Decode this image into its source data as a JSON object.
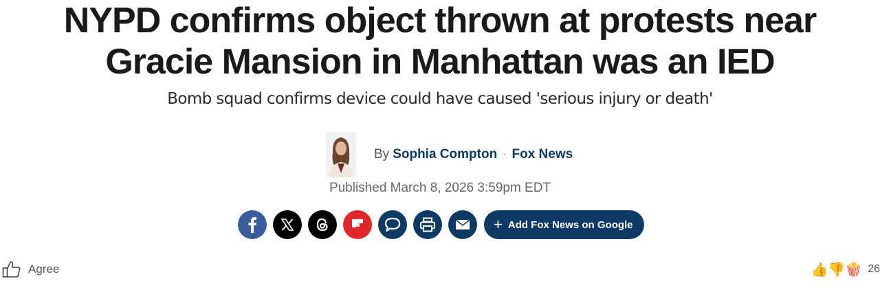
{
  "article": {
    "headline": "NYPD confirms object thrown at protests near Gracie Mansion in Manhattan was an IED",
    "subheadline": "Bomb squad confirms device could have caused 'serious injury or death'",
    "byline": {
      "by_label": "By",
      "author": "Sophia Compton",
      "separator": "·",
      "outlet": "Fox News"
    },
    "published": "Published March 8, 2026 3:59pm EDT"
  },
  "share": {
    "icons": [
      "facebook-icon",
      "x-icon",
      "threads-icon",
      "flipboard-icon",
      "comment-icon",
      "print-icon",
      "email-icon"
    ],
    "google_button_plus": "+",
    "google_button_label": "Add Fox News on Google"
  },
  "footer": {
    "agree_label": "Agree",
    "reaction_emojis": "👍👎🍿",
    "reaction_count": "26"
  },
  "colors": {
    "brand_navy": "#0f3a66",
    "facebook": "#3b5c9c",
    "flipboard": "#e12828"
  }
}
